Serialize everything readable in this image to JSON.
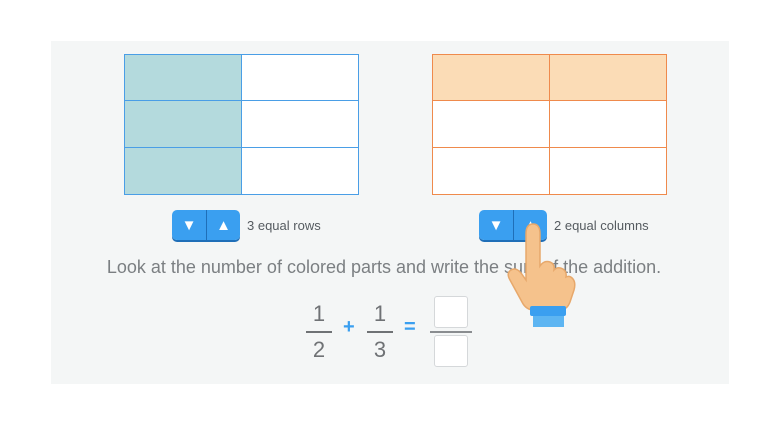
{
  "left_model": {
    "stepper": {
      "down_icon": "▼",
      "up_icon": "▲"
    },
    "label": "3 equal rows",
    "fill_color": "#b4dadd",
    "border_color": "#4a9ee6"
  },
  "right_model": {
    "stepper": {
      "down_icon": "▼",
      "up_icon": "▲"
    },
    "label": "2 equal columns",
    "fill_color": "#fbdcb6",
    "border_color": "#ef8a4c"
  },
  "instruction": "Look at the number of colored parts and write the sum of the addition.",
  "equation": {
    "fraction_a": {
      "numerator": "1",
      "denominator": "2"
    },
    "plus": "+",
    "fraction_b": {
      "numerator": "1",
      "denominator": "3"
    },
    "equals": "=",
    "answer": {
      "numerator": "",
      "denominator": ""
    }
  },
  "cursor": "hand-pointer-icon"
}
